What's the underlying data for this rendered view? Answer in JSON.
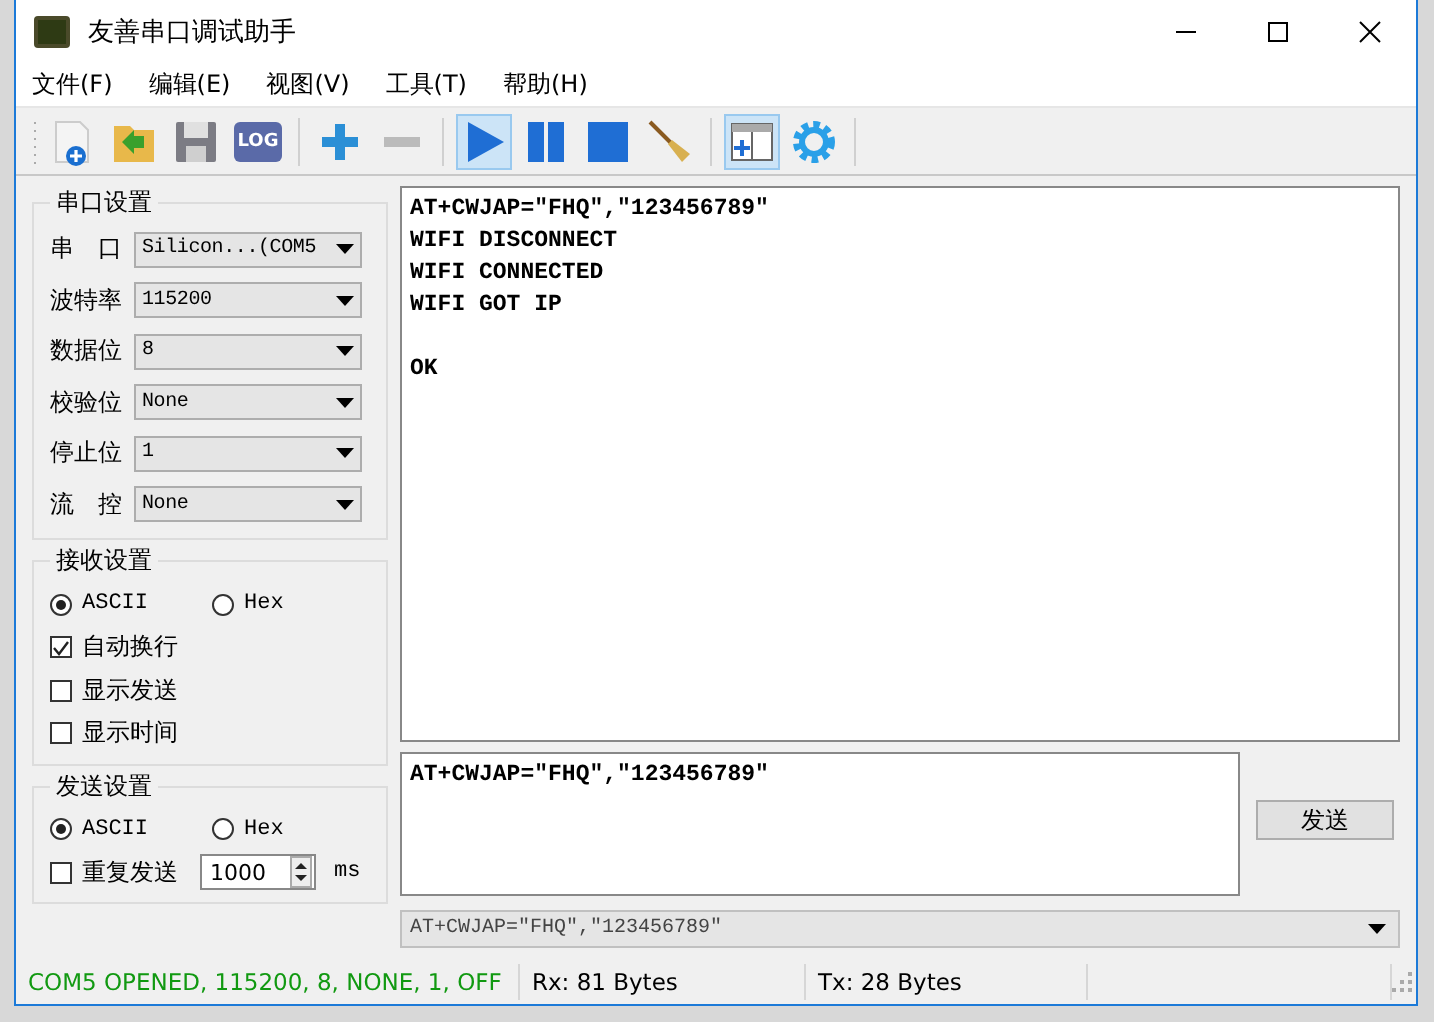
{
  "window": {
    "title": "友善串口调试助手"
  },
  "menu": [
    "文件(F)",
    "编辑(E)",
    "视图(V)",
    "工具(T)",
    "帮助(H)"
  ],
  "toolbar": [
    {
      "kind": "new",
      "pressed": false
    },
    {
      "kind": "open",
      "pressed": false
    },
    {
      "kind": "save",
      "pressed": false
    },
    {
      "kind": "log",
      "label": "LOG",
      "pressed": false
    },
    {
      "kind": "sep"
    },
    {
      "kind": "plus",
      "pressed": false
    },
    {
      "kind": "minus",
      "pressed": false
    },
    {
      "kind": "sep"
    },
    {
      "kind": "play",
      "pressed": true
    },
    {
      "kind": "pause",
      "pressed": false
    },
    {
      "kind": "stop",
      "pressed": false
    },
    {
      "kind": "broom",
      "pressed": false
    },
    {
      "kind": "sep"
    },
    {
      "kind": "panel",
      "pressed": true
    },
    {
      "kind": "gear",
      "pressed": false
    },
    {
      "kind": "sep"
    }
  ],
  "serial_settings": {
    "title": "串口设置",
    "fields": [
      {
        "label": "串　口",
        "value": "Silicon...(COM5"
      },
      {
        "label": "波特率",
        "value": "115200"
      },
      {
        "label": "数据位",
        "value": "8"
      },
      {
        "label": "校验位",
        "value": "None"
      },
      {
        "label": "停止位",
        "value": "1"
      },
      {
        "label": "流　控",
        "value": "None"
      }
    ]
  },
  "receive_settings": {
    "title": "接收设置",
    "modes": [
      {
        "label": "ASCII",
        "selected": true
      },
      {
        "label": "Hex",
        "selected": false
      }
    ],
    "options": [
      {
        "label": "自动换行",
        "checked": true
      },
      {
        "label": "显示发送",
        "checked": false
      },
      {
        "label": "显示时间",
        "checked": false
      }
    ]
  },
  "send_settings": {
    "title": "发送设置",
    "modes": [
      {
        "label": "ASCII",
        "selected": true
      },
      {
        "label": "Hex",
        "selected": false
      }
    ],
    "repeat": {
      "label": "重复发送",
      "checked": false,
      "value": "1000",
      "unit": "ms"
    }
  },
  "receive_text": "AT+CWJAP=\"FHQ\",\"123456789\"\nWIFI DISCONNECT\nWIFI CONNECTED\nWIFI GOT IP\n\nOK",
  "send_text": "AT+CWJAP=\"FHQ\",\"123456789\"",
  "send_button": "发送",
  "history": "AT+CWJAP=\"FHQ\",\"123456789\"",
  "status_bar": [
    {
      "text": "COM5 OPENED, 115200, 8, NONE, 1, OFF",
      "color": "#119911"
    },
    {
      "text": "Rx: 81 Bytes",
      "color": "#000000"
    },
    {
      "text": "Tx: 28 Bytes",
      "color": "#000000"
    }
  ]
}
